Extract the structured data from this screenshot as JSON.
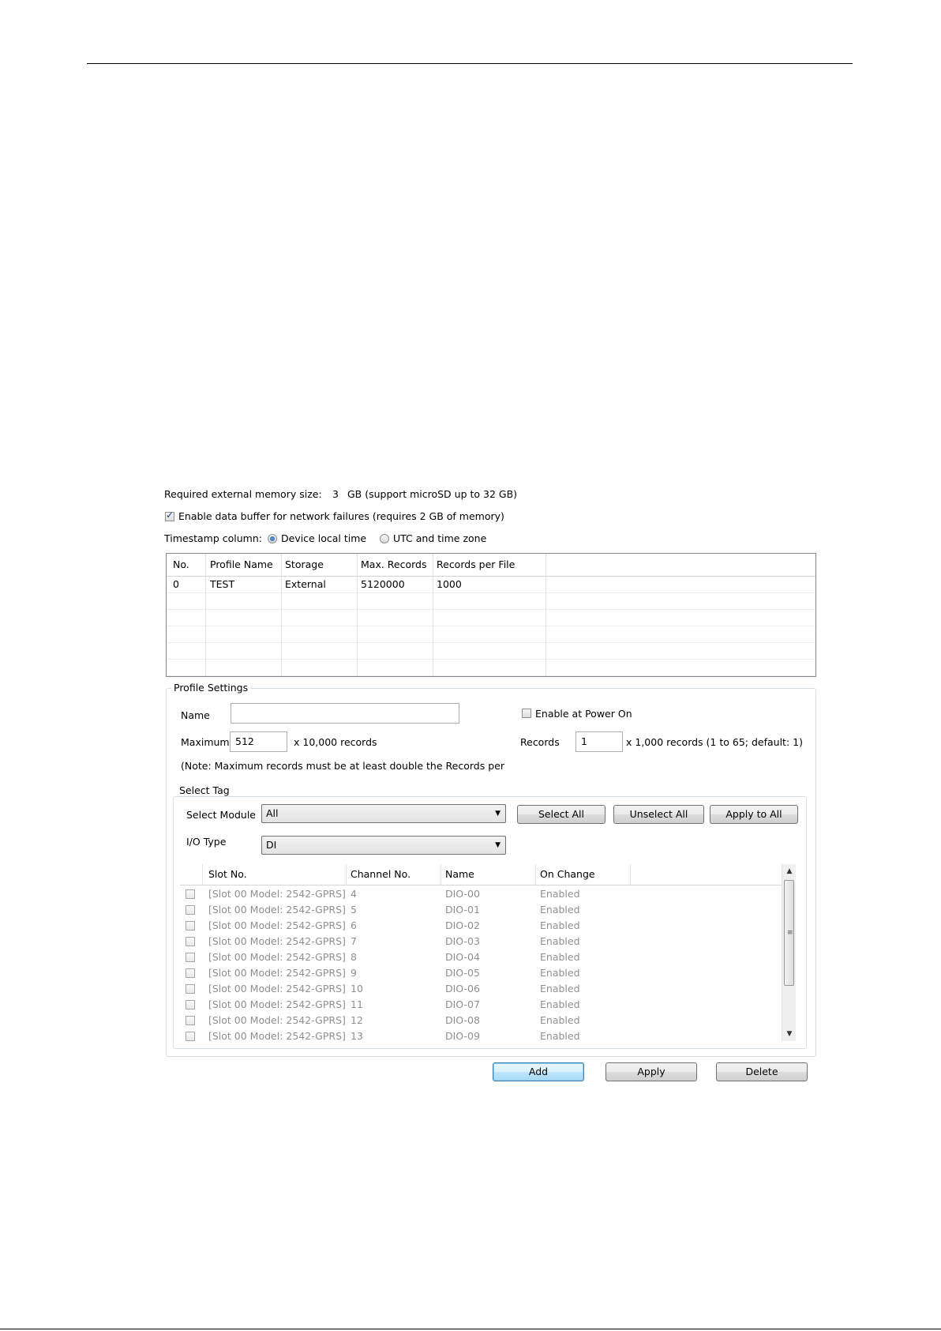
{
  "memory": {
    "label": "Required external memory size:",
    "value": "3",
    "suffix": "GB (support microSD up to 32 GB)"
  },
  "buffer": {
    "label": "Enable data buffer for network failures (requires 2 GB of memory)",
    "checked": true
  },
  "timestamp": {
    "label": "Timestamp column:",
    "option_local": "Device local time",
    "option_utc": "UTC and time zone",
    "selected": "Device local time"
  },
  "profiles_table": {
    "headers": [
      "No.",
      "Profile Name",
      "Storage",
      "Max. Records",
      "Records per File"
    ],
    "rows": [
      [
        "0",
        "TEST",
        "External",
        "5120000",
        "1000"
      ]
    ]
  },
  "profile_settings": {
    "title": "Profile Settings",
    "name_label": "Name",
    "name_value": "",
    "enable_power_on": "Enable at Power On",
    "enable_power_on_checked": false,
    "maximum_label": "Maximum",
    "maximum_value": "512",
    "maximum_unit": "x 10,000 records",
    "records_label": "Records",
    "records_value": "1",
    "records_unit": "x 1,000 records (1 to 65; default: 1)",
    "note": "(Note: Maximum records must be at least double the Records per"
  },
  "select_tag": {
    "title": "Select Tag",
    "module_label": "Select Module",
    "module_value": "All",
    "io_type_label": "I/O Type",
    "io_type_value": "DI",
    "select_all": "Select All",
    "unselect_all": "Unselect All",
    "apply_to_all": "Apply to All",
    "headers": [
      "Slot No.",
      "Channel No.",
      "Name",
      "On Change"
    ],
    "rows": [
      [
        "[Slot 00 Model: 2542-GPRS]",
        "4",
        "DIO-00",
        "Enabled"
      ],
      [
        "[Slot 00 Model: 2542-GPRS]",
        "5",
        "DIO-01",
        "Enabled"
      ],
      [
        "[Slot 00 Model: 2542-GPRS]",
        "6",
        "DIO-02",
        "Enabled"
      ],
      [
        "[Slot 00 Model: 2542-GPRS]",
        "7",
        "DIO-03",
        "Enabled"
      ],
      [
        "[Slot 00 Model: 2542-GPRS]",
        "8",
        "DIO-04",
        "Enabled"
      ],
      [
        "[Slot 00 Model: 2542-GPRS]",
        "9",
        "DIO-05",
        "Enabled"
      ],
      [
        "[Slot 00 Model: 2542-GPRS]",
        "10",
        "DIO-06",
        "Enabled"
      ],
      [
        "[Slot 00 Model: 2542-GPRS]",
        "11",
        "DIO-07",
        "Enabled"
      ],
      [
        "[Slot 00 Model: 2542-GPRS]",
        "12",
        "DIO-08",
        "Enabled"
      ],
      [
        "[Slot 00 Model: 2542-GPRS]",
        "13",
        "DIO-09",
        "Enabled"
      ]
    ]
  },
  "actions": {
    "add": "Add",
    "apply": "Apply",
    "delete": "Delete"
  }
}
